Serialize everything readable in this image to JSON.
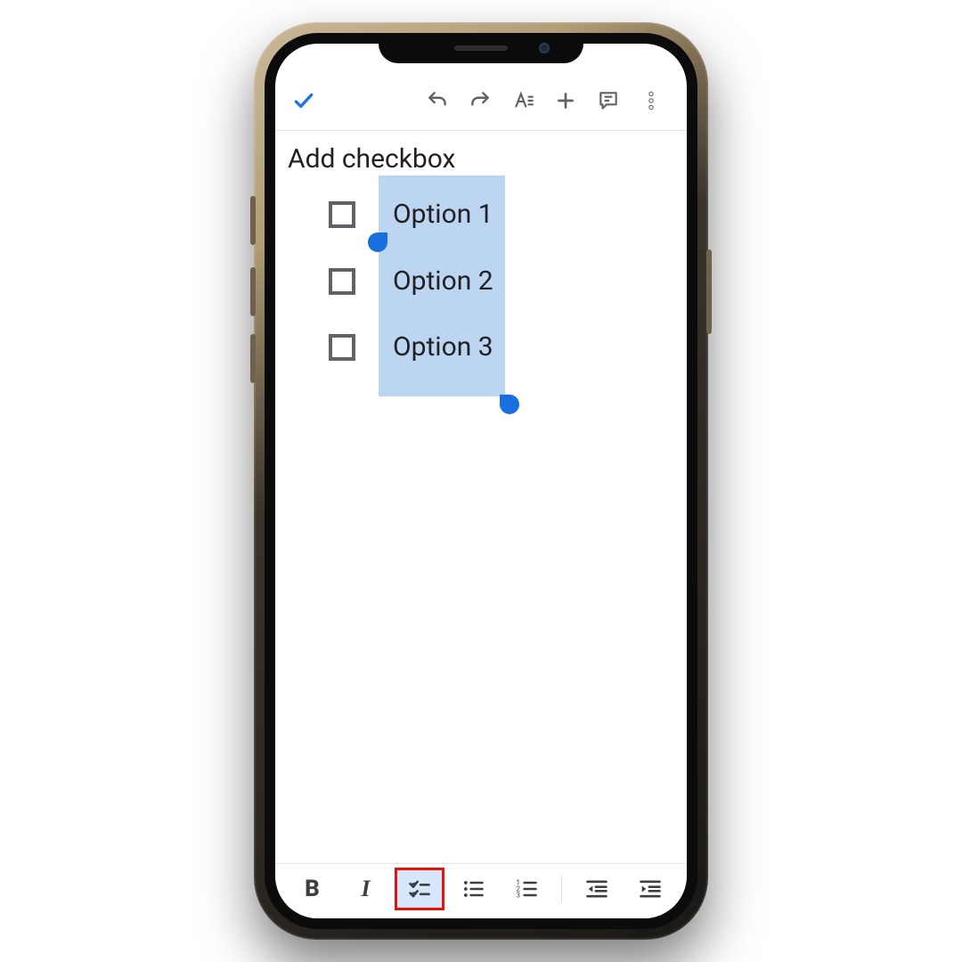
{
  "document": {
    "title": "Add checkbox",
    "checklist": [
      {
        "label": "Option 1",
        "checked": false
      },
      {
        "label": "Option 2",
        "checked": false
      },
      {
        "label": "Option 3",
        "checked": false
      }
    ],
    "selection": {
      "highlight_color": "#bcd5f0"
    }
  },
  "toolbar_top": {
    "done": "done-check",
    "undo": "undo",
    "redo": "redo",
    "text_format": "text-format",
    "insert": "insert",
    "comment": "comment",
    "overflow": "overflow"
  },
  "format_bar": {
    "bold": "B",
    "italic": "I",
    "checklist": "checklist",
    "bulleted": "bulleted-list",
    "numbered": "numbered-list",
    "outdent": "outdent",
    "indent": "indent",
    "active": "checklist"
  },
  "annotation": {
    "highlight_button": "checklist",
    "highlight_color": "#e3120b"
  }
}
